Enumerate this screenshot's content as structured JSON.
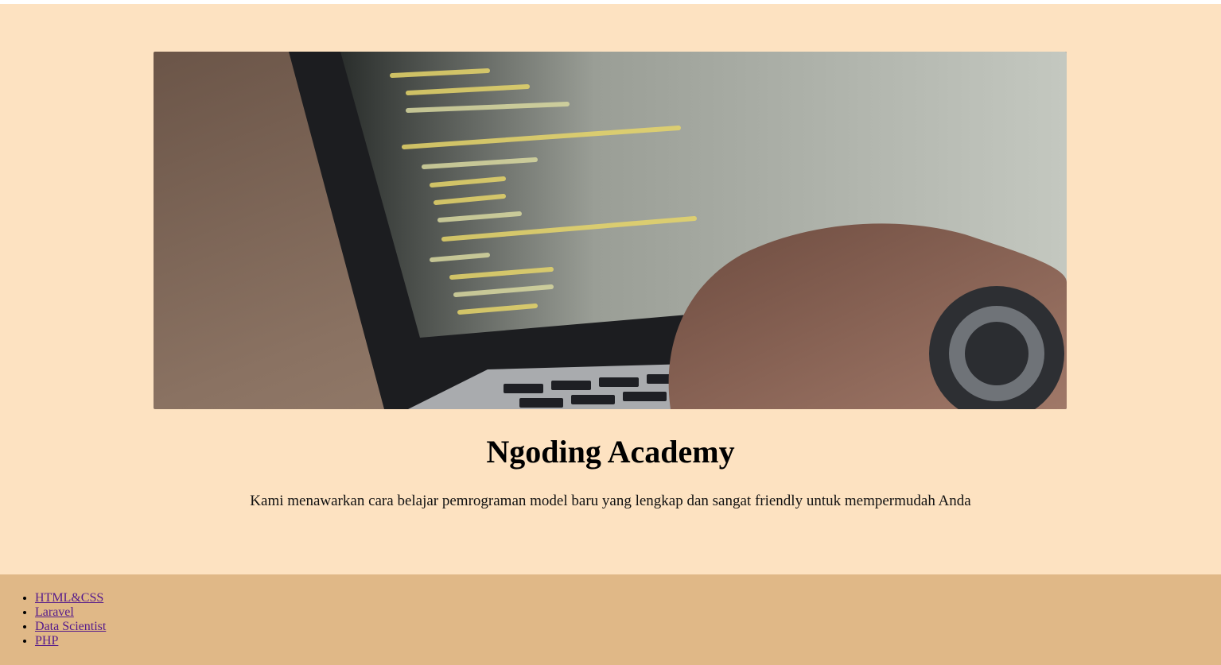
{
  "hero": {
    "title": "Ngoding Academy",
    "description": "Kami menawarkan cara belajar pemrograman model baru yang lengkap dan sangat friendly untuk mempermudah Anda",
    "image_alt": "laptop with code editor"
  },
  "footer": {
    "links": [
      {
        "label": "HTML&CSS"
      },
      {
        "label": "Laravel"
      },
      {
        "label": "Data Scientist"
      },
      {
        "label": "PHP"
      }
    ]
  },
  "colors": {
    "hero_background": "#fde2c1",
    "footer_background": "#e0b887",
    "link": "#551a8b"
  }
}
